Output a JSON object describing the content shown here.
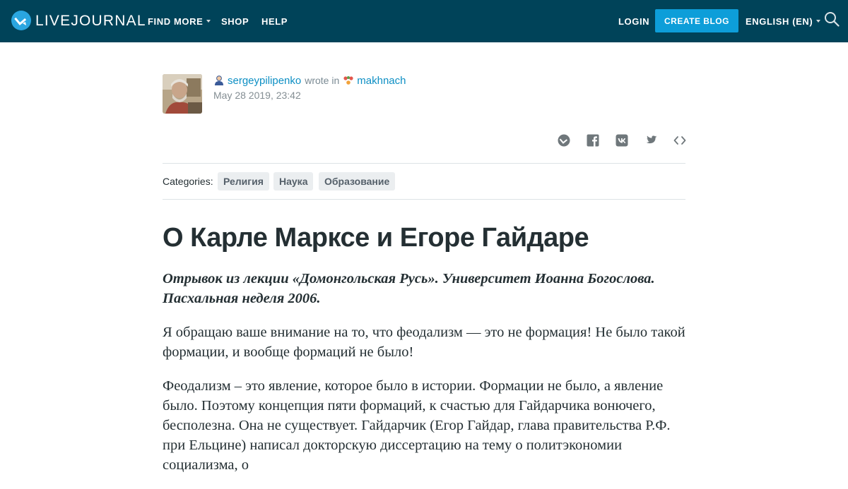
{
  "header": {
    "logo_text": "LIVEJOURNAL",
    "nav": {
      "find_more": "FIND MORE",
      "shop": "SHOP",
      "help": "HELP"
    },
    "login": "LOGIN",
    "create_blog": "CREATE BLOG",
    "language": "ENGLISH (EN)"
  },
  "post": {
    "author": "sergeypilipenko",
    "wrote_in": "wrote in",
    "community": "makhnach",
    "date": "May 28 2019, 23:42",
    "categories_label": "Categories:",
    "categories": [
      "Религия",
      "Наука",
      "Образование"
    ],
    "title": "О Карле Марксе и Егоре Гайдаре",
    "lead": "Отрывок из лекции «Домонгольская Русь». Университет Иоанна Богослова. Пасхальная неделя 2006.",
    "paragraphs": [
      "Я обращаю ваше внимание на то, что феодализм — это не формация! Не было такой формации, и вообще формаций не было!",
      "Феодализм – это явление, которое было в истории. Формации не было, а явление было. Поэтому концепция пяти формаций, к счастью для Гайдарчика вонючего, бесполезна. Она не существует. Гайдарчик (Егор Гайдар, глава правительства Р.Ф. при Ельцине) написал докторскую диссертацию на тему о политэкономии социализма, о"
    ]
  },
  "colors": {
    "header_bg": "#004359",
    "accent": "#0d9ed9",
    "link": "#0d8fc4",
    "tag_bg": "#ebeef0"
  },
  "icons": {
    "share": [
      "livejournal-share-icon",
      "facebook-icon",
      "vk-icon",
      "twitter-icon",
      "embed-code-icon"
    ],
    "search": "search-icon"
  }
}
